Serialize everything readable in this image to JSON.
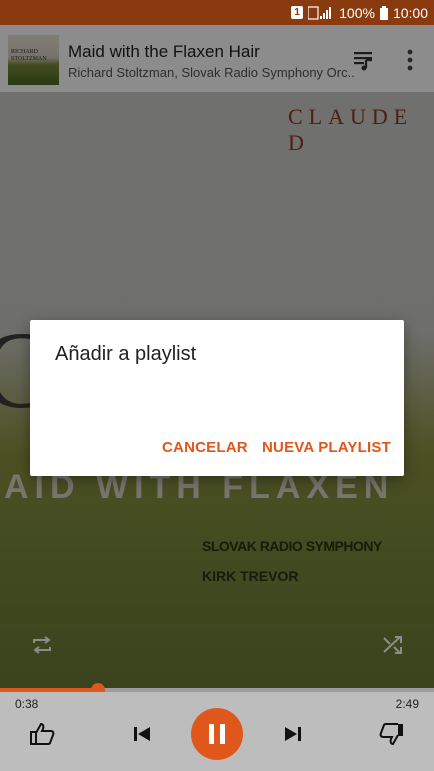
{
  "status_bar": {
    "sim": "1",
    "battery": "100%",
    "time": "10:00"
  },
  "now_playing": {
    "title": "Maid with the Flaxen Hair",
    "artist": "Richard Stoltzman, Slovak Radio Symphony Orc..",
    "thumb_text_1": "RICHARD",
    "thumb_text_2": "STOLTZMAN"
  },
  "album_art": {
    "top_text": "CLAUDE D",
    "middle_text": "AID WITH FLAXEN",
    "orchestra": "SLOVAK RADIO SYMPHONY",
    "conductor": "KIRK TREVOR",
    "big_letter": "C"
  },
  "player": {
    "elapsed": "0:38",
    "total": "2:49",
    "progress": 0.225
  },
  "dialog": {
    "title": "Añadir a playlist",
    "cancel_label": "CANCELAR",
    "new_playlist_label": "NUEVA PLAYLIST"
  },
  "colors": {
    "accent": "#e0571c",
    "status_bar": "#8a3a0f"
  }
}
